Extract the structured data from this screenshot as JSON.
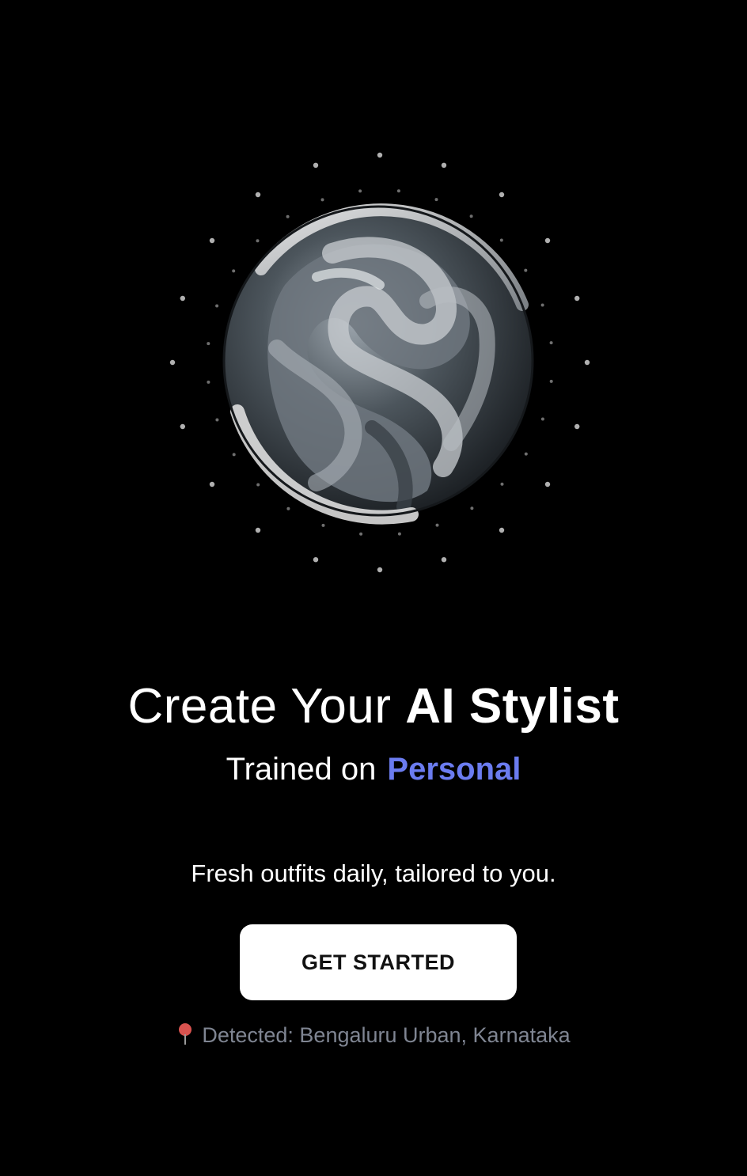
{
  "headline": {
    "prefix": "Create Your",
    "emphasis": "AI Stylist"
  },
  "subheadline": {
    "prefix": "Trained on",
    "highlight": "Personal"
  },
  "tagline": "Fresh outfits daily, tailored to you.",
  "cta": {
    "label": "GET STARTED"
  },
  "location": {
    "icon": "map-pin-icon",
    "text": "Detected: Bengaluru Urban, Karnataka"
  },
  "colors": {
    "background": "#000000",
    "accent": "#6b7cf0",
    "muted": "#7f8592",
    "pin": "#d9534f"
  }
}
